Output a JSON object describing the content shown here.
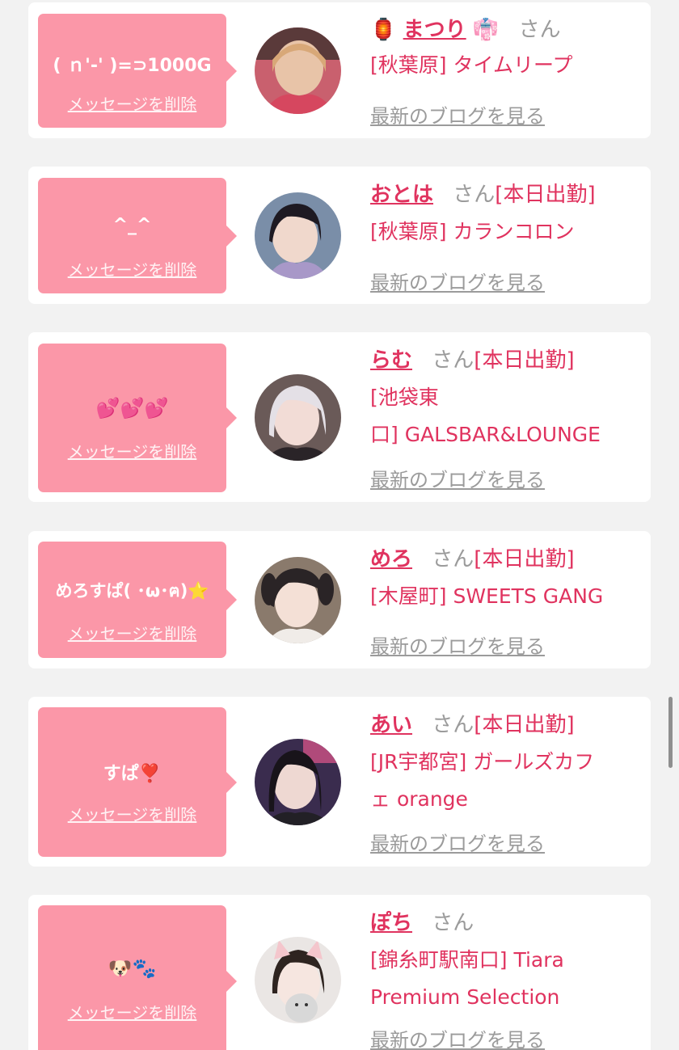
{
  "cards": [
    {
      "message": "( ｎ'-' )=⊃1000G",
      "delete_label": "メッセージを削除",
      "name_prefix": "🏮",
      "name": "まつり",
      "name_suffix": "👘",
      "honorific": "さん",
      "status": "",
      "shop": "[秋葉原] タイムリープ",
      "blog_label": "最新のブログを見る"
    },
    {
      "message": "^_^",
      "delete_label": "メッセージを削除",
      "name": "おとは",
      "honorific": "さん",
      "status": "[本日出勤]",
      "shop": "[秋葉原] カランコロン",
      "blog_label": "最新のブログを見る"
    },
    {
      "message": "💕💕💕",
      "delete_label": "メッセージを削除",
      "name": "らむ",
      "honorific": "さん",
      "status": "[本日出勤]",
      "shop_line1": "[池袋東",
      "shop_line2": "口] GALSBAR&LOUNGE",
      "blog_label": "最新のブログを見る"
    },
    {
      "message": "めろすぱ( ･ω･ฅ)⭐",
      "delete_label": "メッセージを削除",
      "name": "めろ",
      "honorific": "さん",
      "status": "[本日出勤]",
      "shop": "[木屋町] SWEETS GANG",
      "blog_label": "最新のブログを見る"
    },
    {
      "message": "すぱ❣️",
      "delete_label": "メッセージを削除",
      "name": "あい",
      "honorific": "さん",
      "status": "[本日出勤]",
      "shop_line1": "[JR宇都宮] ガールズカフ",
      "shop_line2": "ェ orange",
      "blog_label": "最新のブログを見る"
    },
    {
      "message": "🐶🐾",
      "delete_label": "メッセージを削除",
      "name": "ぽち",
      "honorific": "さん",
      "status": "",
      "shop_line1": "[錦糸町駅南口] Tiara",
      "shop_line2": "Premium Selection",
      "blog_label": "最新のブログを見る"
    }
  ],
  "colors": {
    "bubble": "#fb97a8",
    "name": "#e0335f",
    "muted": "#9b9b9b",
    "background": "#f2f2f2"
  }
}
